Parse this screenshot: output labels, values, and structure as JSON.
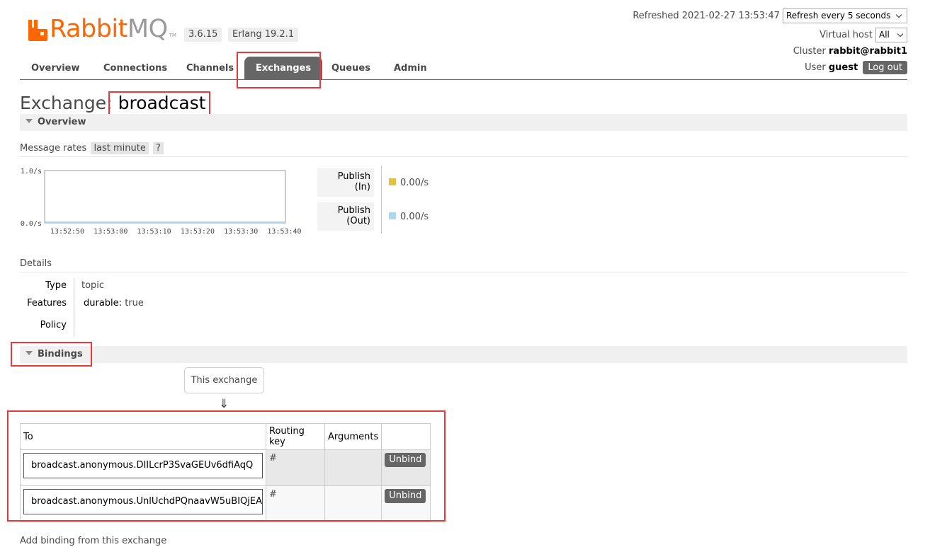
{
  "header": {
    "logo_rabbit": "Rabbit",
    "logo_mq": "MQ",
    "logo_tm": "TM",
    "version": "3.6.15",
    "erlang": "Erlang 19.2.1",
    "refreshed_label": "Refreshed 2021-02-27 13:53:47",
    "refresh_select": "Refresh every 5 seconds",
    "vhost_label": "Virtual host",
    "vhost_value": "All",
    "cluster_label": "Cluster",
    "cluster_value": "rabbit@rabbit1",
    "user_label": "User",
    "user_value": "guest",
    "logout": "Log out"
  },
  "tabs": [
    "Overview",
    "Connections",
    "Channels",
    "Exchanges",
    "Queues",
    "Admin"
  ],
  "active_tab": "Exchanges",
  "page": {
    "title_prefix": "Exchange:",
    "title_name": "broadcast"
  },
  "overview": {
    "section": "Overview",
    "message_rates_label": "Message rates",
    "range": "last minute",
    "help": "?"
  },
  "chart_data": {
    "type": "line",
    "x": [
      "13:52:50",
      "13:53:00",
      "13:53:10",
      "13:53:20",
      "13:53:30",
      "13:53:40"
    ],
    "y_ticks": [
      "1.0/s",
      "0.0/s"
    ],
    "ylim": [
      0,
      1
    ],
    "series": [
      {
        "name": "Publish (In)",
        "color": "#e6c13e",
        "values": [
          0,
          0,
          0,
          0,
          0,
          0
        ],
        "rate": "0.00/s"
      },
      {
        "name": "Publish (Out)",
        "color": "#aed7f4",
        "values": [
          0,
          0,
          0,
          0,
          0,
          0
        ],
        "rate": "0.00/s"
      }
    ],
    "legend_labels": [
      {
        "line1": "Publish",
        "line2": "(In)"
      },
      {
        "line1": "Publish",
        "line2": "(Out)"
      }
    ]
  },
  "details": {
    "heading": "Details",
    "type_label": "Type",
    "type_value": "topic",
    "features_label": "Features",
    "features_key": "durable:",
    "features_value": "true",
    "policy_label": "Policy"
  },
  "bindings": {
    "section": "Bindings",
    "this_exchange": "This exchange",
    "arrow": "⇓",
    "columns": [
      "To",
      "Routing key",
      "Arguments",
      ""
    ],
    "rows": [
      {
        "to": "broadcast.anonymous.DIILcrP3SvaGEUv6dfiAqQ",
        "routing_key": "#",
        "arguments": "",
        "action": "Unbind"
      },
      {
        "to": "broadcast.anonymous.UnlUchdPQnaavW5uBIQjEA",
        "routing_key": "#",
        "arguments": "",
        "action": "Unbind"
      }
    ],
    "add_binding": "Add binding from this exchange"
  }
}
